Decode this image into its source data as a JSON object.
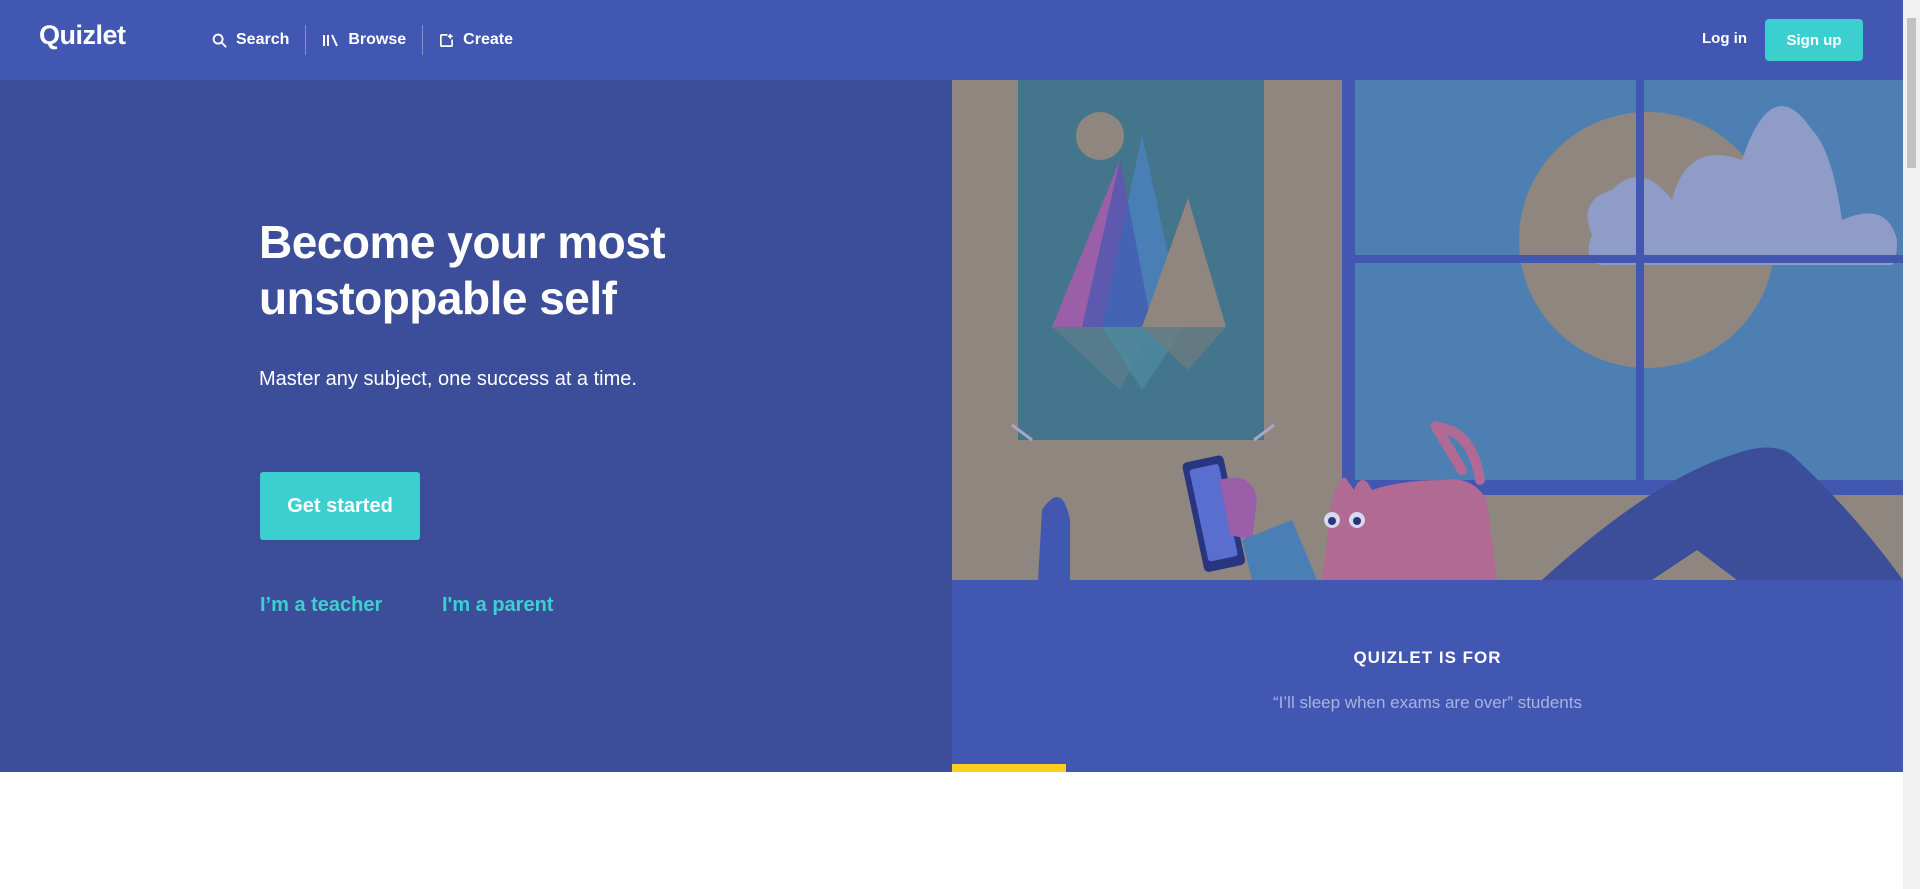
{
  "header": {
    "logo": "Quizlet",
    "nav": [
      {
        "label": "Search",
        "icon": "search-icon"
      },
      {
        "label": "Browse",
        "icon": "library-icon"
      },
      {
        "label": "Create",
        "icon": "create-icon"
      }
    ],
    "login_label": "Log in",
    "signup_label": "Sign up"
  },
  "hero": {
    "title": "Become your most unstoppable self",
    "subtitle": "Master any subject, one success at a time.",
    "cta_label": "Get started",
    "teacher_link": "I’m a teacher",
    "parent_link": "I'm a parent"
  },
  "quizlet_for": {
    "heading": "QUIZLET IS FOR",
    "quote": "“I’ll sleep when exams are over” students",
    "progress": 0.12
  },
  "colors": {
    "header_bg": "#4257b2",
    "hero_bg": "#3c4e9a",
    "accent": "#3ccfcf",
    "progress": "#ffcd1f"
  }
}
